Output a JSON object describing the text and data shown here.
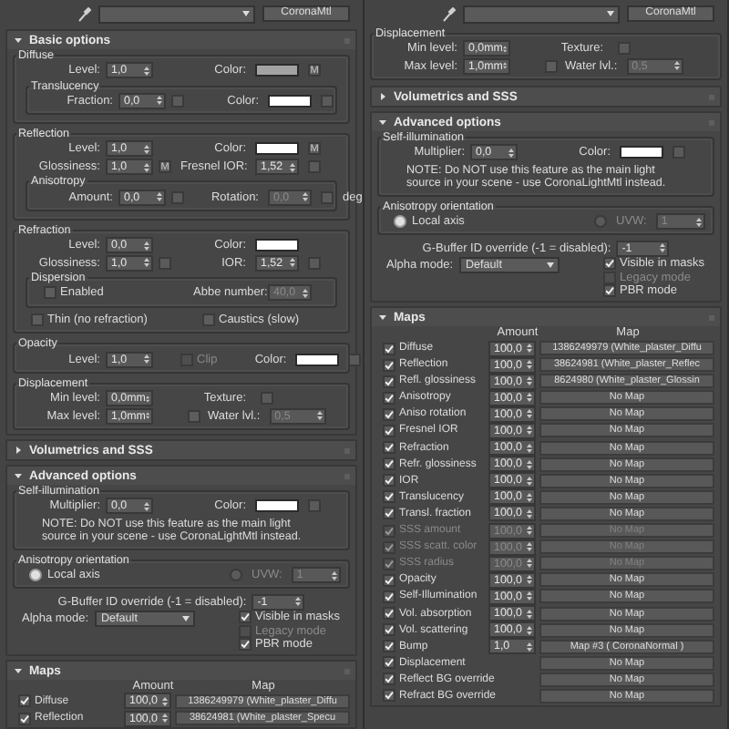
{
  "panels": [
    {
      "toolbar": {
        "material_type": "CoronaMtl"
      },
      "sections": [
        {
          "kind": "rollout",
          "title": "Basic options",
          "expanded": true,
          "content": [
            {
              "kind": "group",
              "title": "Diffuse",
              "content": [
                {
                  "kind": "row",
                  "items": [
                    {
                      "kind": "spinner",
                      "label": "Level:",
                      "value": "1,0"
                    },
                    {
                      "kind": "color",
                      "label": "Color:",
                      "color": "#a3a3a3",
                      "map_label": "M"
                    }
                  ]
                },
                {
                  "kind": "group",
                  "title": "Translucency",
                  "content": [
                    {
                      "kind": "row",
                      "items": [
                        {
                          "kind": "spinner",
                          "label": "Fraction:",
                          "value": "0,0",
                          "slot": true
                        },
                        {
                          "kind": "color",
                          "label": "Color:",
                          "color": "#ffffff",
                          "slot": true
                        }
                      ]
                    }
                  ]
                }
              ]
            },
            {
              "kind": "group",
              "title": "Reflection",
              "content": [
                {
                  "kind": "row",
                  "items": [
                    {
                      "kind": "spinner",
                      "label": "Level:",
                      "value": "1,0"
                    },
                    {
                      "kind": "color",
                      "label": "Color:",
                      "color": "#ffffff",
                      "map_label": "M"
                    }
                  ]
                },
                {
                  "kind": "row",
                  "items": [
                    {
                      "kind": "spinner",
                      "label": "Glossiness:",
                      "value": "1,0",
                      "map_label": "M"
                    },
                    {
                      "kind": "spinner",
                      "label": "Fresnel IOR:",
                      "value": "1,52",
                      "slot": true
                    }
                  ]
                },
                {
                  "kind": "group",
                  "title": "Anisotropy",
                  "content": [
                    {
                      "kind": "row",
                      "items": [
                        {
                          "kind": "spinner",
                          "label": "Amount:",
                          "value": "0,0",
                          "slot": true
                        },
                        {
                          "kind": "spinner",
                          "label": "Rotation:",
                          "value": "0,0",
                          "disabled": true,
                          "slot": true,
                          "suffix": "deg"
                        }
                      ]
                    }
                  ]
                }
              ]
            },
            {
              "kind": "group",
              "title": "Refraction",
              "content": [
                {
                  "kind": "row",
                  "items": [
                    {
                      "kind": "spinner",
                      "label": "Level:",
                      "value": "0,0"
                    },
                    {
                      "kind": "color",
                      "label": "Color:",
                      "color": "#ffffff"
                    }
                  ]
                },
                {
                  "kind": "row",
                  "items": [
                    {
                      "kind": "spinner",
                      "label": "Glossiness:",
                      "value": "1,0",
                      "slot": true
                    },
                    {
                      "kind": "spinner",
                      "label": "IOR:",
                      "value": "1,52",
                      "slot": true
                    }
                  ]
                },
                {
                  "kind": "group",
                  "title": "Dispersion",
                  "content": [
                    {
                      "kind": "row",
                      "items": [
                        {
                          "kind": "checkbox",
                          "label": "Enabled",
                          "checked": false
                        },
                        {
                          "kind": "spinner",
                          "label": "Abbe number:",
                          "value": "40,0",
                          "disabled": true
                        }
                      ]
                    }
                  ]
                },
                {
                  "kind": "row",
                  "items": [
                    {
                      "kind": "checkbox",
                      "label": "Thin (no refraction)",
                      "checked": false
                    },
                    {
                      "kind": "checkbox",
                      "label": "Caustics (slow)",
                      "checked": false
                    }
                  ]
                }
              ]
            },
            {
              "kind": "group",
              "title": "Opacity",
              "content": [
                {
                  "kind": "row",
                  "items": [
                    {
                      "kind": "spinner",
                      "label": "Level:",
                      "value": "1,0"
                    },
                    {
                      "kind": "checkbox",
                      "label": "Clip",
                      "checked": false,
                      "disabled": true
                    },
                    {
                      "kind": "color",
                      "label": "Color:",
                      "color": "#ffffff",
                      "slot": true
                    }
                  ]
                }
              ]
            },
            {
              "kind": "group",
              "title": "Displacement",
              "content": [
                {
                  "kind": "row",
                  "items": [
                    {
                      "kind": "spinner",
                      "label": "Min level:",
                      "value": "0,0mm"
                    },
                    {
                      "kind": "texture",
                      "label": "Texture:"
                    }
                  ]
                },
                {
                  "kind": "row",
                  "items": [
                    {
                      "kind": "spinner",
                      "label": "Max level:",
                      "value": "1,0mm"
                    },
                    {
                      "kind": "checkspinner",
                      "label": "Water lvl.:",
                      "value": "0,5",
                      "checked": false,
                      "disabled": true
                    }
                  ]
                }
              ]
            }
          ]
        },
        {
          "kind": "rollout",
          "title": "Volumetrics and SSS",
          "expanded": false
        },
        {
          "kind": "rollout",
          "title": "Advanced options",
          "expanded": true,
          "content": [
            {
              "kind": "group",
              "title": "Self-illumination",
              "content": [
                {
                  "kind": "row",
                  "items": [
                    {
                      "kind": "spinner",
                      "label": "Multiplier:",
                      "value": "0,0"
                    },
                    {
                      "kind": "color",
                      "label": "Color:",
                      "color": "#ffffff",
                      "slot": true
                    }
                  ]
                },
                {
                  "kind": "note",
                  "text": "NOTE: Do NOT use this feature as the main light source in your scene - use CoronaLightMtl instead."
                }
              ]
            },
            {
              "kind": "group",
              "title": "Anisotropy orientation",
              "content": [
                {
                  "kind": "row",
                  "items": [
                    {
                      "kind": "radio",
                      "label": "Local axis",
                      "selected": true
                    },
                    {
                      "kind": "radio_spinner",
                      "label": "UVW:",
                      "value": "1",
                      "selected": false,
                      "disabled": true
                    }
                  ]
                }
              ]
            },
            {
              "kind": "center_row",
              "items": [
                {
                  "kind": "spinner_wide",
                  "label": "G-Buffer ID override (-1 = disabled):",
                  "value": "-1"
                }
              ]
            },
            {
              "kind": "alpha",
              "label": "Alpha mode:",
              "value": "Default",
              "checks": [
                {
                  "label": "Visible in masks",
                  "checked": true,
                  "disabled": false
                },
                {
                  "label": "Legacy mode",
                  "checked": false,
                  "disabled": true
                },
                {
                  "label": "PBR mode",
                  "checked": true,
                  "disabled": false
                }
              ]
            }
          ]
        },
        {
          "kind": "rollout",
          "title": "Maps",
          "expanded": true,
          "content": [
            {
              "kind": "maps",
              "columns": [
                "Amount",
                "Map"
              ],
              "rows": [
                {
                  "name": "Diffuse",
                  "checked": true,
                  "disabled": false,
                  "amount": "100,0",
                  "map": "1386249979 (White_plaster_Diffu"
                },
                {
                  "name": "Reflection",
                  "checked": true,
                  "disabled": false,
                  "amount": "100,0",
                  "map": "38624981 (White_plaster_Specu"
                }
              ]
            }
          ]
        }
      ]
    },
    {
      "toolbar": {
        "material_type": "CoronaMtl"
      },
      "sections": [
        {
          "kind": "group",
          "title": "Displacement",
          "content": [
            {
              "kind": "row",
              "items": [
                {
                  "kind": "spinner",
                  "label": "Min level:",
                  "value": "0,0mm"
                },
                {
                  "kind": "texture",
                  "label": "Texture:"
                }
              ]
            },
            {
              "kind": "row",
              "items": [
                {
                  "kind": "spinner",
                  "label": "Max level:",
                  "value": "1,0mm"
                },
                {
                  "kind": "checkspinner",
                  "label": "Water lvl.:",
                  "value": "0,5",
                  "checked": false,
                  "disabled": true
                }
              ]
            }
          ]
        },
        {
          "kind": "rollout",
          "title": "Volumetrics and SSS",
          "expanded": false
        },
        {
          "kind": "rollout",
          "title": "Advanced options",
          "expanded": true,
          "content": [
            {
              "kind": "group",
              "title": "Self-illumination",
              "content": [
                {
                  "kind": "row",
                  "items": [
                    {
                      "kind": "spinner",
                      "label": "Multiplier:",
                      "value": "0,0"
                    },
                    {
                      "kind": "color",
                      "label": "Color:",
                      "color": "#ffffff",
                      "slot": true
                    }
                  ]
                },
                {
                  "kind": "note",
                  "text": "NOTE: Do NOT use this feature as the main light source in your scene - use CoronaLightMtl instead."
                }
              ]
            },
            {
              "kind": "group",
              "title": "Anisotropy orientation",
              "content": [
                {
                  "kind": "row",
                  "items": [
                    {
                      "kind": "radio",
                      "label": "Local axis",
                      "selected": true
                    },
                    {
                      "kind": "radio_spinner",
                      "label": "UVW:",
                      "value": "1",
                      "selected": false,
                      "disabled": true
                    }
                  ]
                }
              ]
            },
            {
              "kind": "center_row",
              "items": [
                {
                  "kind": "spinner_wide",
                  "label": "G-Buffer ID override (-1 = disabled):",
                  "value": "-1"
                }
              ]
            },
            {
              "kind": "alpha",
              "label": "Alpha mode:",
              "value": "Default",
              "checks": [
                {
                  "label": "Visible in masks",
                  "checked": true,
                  "disabled": false
                },
                {
                  "label": "Legacy mode",
                  "checked": false,
                  "disabled": true
                },
                {
                  "label": "PBR mode",
                  "checked": true,
                  "disabled": false
                }
              ]
            }
          ]
        },
        {
          "kind": "rollout",
          "title": "Maps",
          "expanded": true,
          "content": [
            {
              "kind": "maps",
              "columns": [
                "Amount",
                "Map"
              ],
              "rows": [
                {
                  "name": "Diffuse",
                  "checked": true,
                  "disabled": false,
                  "amount": "100,0",
                  "map": "1386249979 (White_plaster_Diffu"
                },
                {
                  "name": "Reflection",
                  "checked": true,
                  "disabled": false,
                  "amount": "100,0",
                  "map": "38624981 (White_plaster_Reflec"
                },
                {
                  "name": "Refl. glossiness",
                  "checked": true,
                  "disabled": false,
                  "amount": "100,0",
                  "map": "8624980 (White_plaster_Glossin"
                },
                {
                  "name": "Anisotropy",
                  "checked": true,
                  "disabled": false,
                  "amount": "100,0",
                  "map": "No Map"
                },
                {
                  "name": "Aniso rotation",
                  "checked": true,
                  "disabled": false,
                  "amount": "100,0",
                  "map": "No Map"
                },
                {
                  "name": "Fresnel IOR",
                  "checked": true,
                  "disabled": false,
                  "amount": "100,0",
                  "map": "No Map"
                },
                {
                  "name": "Refraction",
                  "checked": true,
                  "disabled": false,
                  "amount": "100,0",
                  "map": "No Map"
                },
                {
                  "name": "Refr. glossiness",
                  "checked": true,
                  "disabled": false,
                  "amount": "100,0",
                  "map": "No Map"
                },
                {
                  "name": "IOR",
                  "checked": true,
                  "disabled": false,
                  "amount": "100,0",
                  "map": "No Map"
                },
                {
                  "name": "Translucency",
                  "checked": true,
                  "disabled": false,
                  "amount": "100,0",
                  "map": "No Map"
                },
                {
                  "name": "Transl. fraction",
                  "checked": true,
                  "disabled": false,
                  "amount": "100,0",
                  "map": "No Map"
                },
                {
                  "name": "SSS amount",
                  "checked": true,
                  "disabled": true,
                  "amount": "100,0",
                  "map": "No Map"
                },
                {
                  "name": "SSS scatt. color",
                  "checked": true,
                  "disabled": true,
                  "amount": "100,0",
                  "map": "No Map"
                },
                {
                  "name": "SSS radius",
                  "checked": true,
                  "disabled": true,
                  "amount": "100,0",
                  "map": "No Map"
                },
                {
                  "name": "Opacity",
                  "checked": true,
                  "disabled": false,
                  "amount": "100,0",
                  "map": "No Map"
                },
                {
                  "name": "Self-Illumination",
                  "checked": true,
                  "disabled": false,
                  "amount": "100,0",
                  "map": "No Map"
                },
                {
                  "name": "Vol. absorption",
                  "checked": true,
                  "disabled": false,
                  "amount": "100,0",
                  "map": "No Map"
                },
                {
                  "name": "Vol. scattering",
                  "checked": true,
                  "disabled": false,
                  "amount": "100,0",
                  "map": "No Map"
                },
                {
                  "name": "Bump",
                  "checked": true,
                  "disabled": false,
                  "amount": "1,0",
                  "map": "Map #3  ( CoronaNormal )"
                },
                {
                  "name": "Displacement",
                  "checked": true,
                  "disabled": false,
                  "map": "No Map"
                },
                {
                  "name": "Reflect BG override",
                  "checked": true,
                  "disabled": false,
                  "map": "No Map"
                },
                {
                  "name": "Refract BG override",
                  "checked": true,
                  "disabled": false,
                  "map": "No Map"
                }
              ]
            }
          ]
        }
      ]
    }
  ]
}
